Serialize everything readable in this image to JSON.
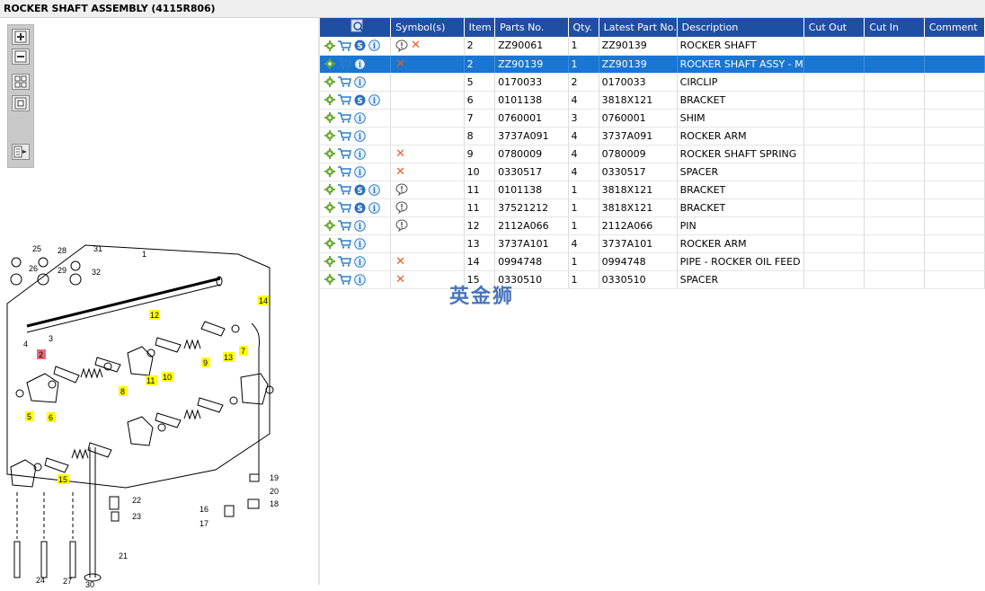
{
  "window": {
    "title": "ROCKER SHAFT ASSEMBLY (4115R806)"
  },
  "toolbar": {
    "buttons": [
      "zoom-in-icon",
      "zoom-out-icon",
      "fit-icon",
      "actual-size-icon",
      "export-icon"
    ]
  },
  "grid": {
    "headers": {
      "icons": "",
      "symbols": "Symbol(s)",
      "item": "Item",
      "parts_no": "Parts No.",
      "qty": "Qty.",
      "latest": "Latest Part No.",
      "description": "Description",
      "cut_out": "Cut Out",
      "cut_in": "Cut In",
      "comment": "Comment"
    },
    "rows": [
      {
        "item": "2",
        "parts_no": "ZZ90061",
        "qty": "1",
        "latest": "ZZ90139",
        "description": "ROCKER SHAFT",
        "s": true,
        "note": true,
        "x": true,
        "selected": false
      },
      {
        "item": "2",
        "parts_no": "ZZ90139",
        "qty": "1",
        "latest": "ZZ90139",
        "description": "ROCKER SHAFT ASSY - M",
        "s": false,
        "note": false,
        "x": true,
        "selected": true
      },
      {
        "item": "5",
        "parts_no": "0170033",
        "qty": "2",
        "latest": "0170033",
        "description": "CIRCLIP",
        "s": false,
        "note": false,
        "x": false,
        "selected": false
      },
      {
        "item": "6",
        "parts_no": "0101138",
        "qty": "4",
        "latest": "3818X121",
        "description": "BRACKET",
        "s": true,
        "note": false,
        "x": false,
        "selected": false
      },
      {
        "item": "7",
        "parts_no": "0760001",
        "qty": "3",
        "latest": "0760001",
        "description": "SHIM",
        "s": false,
        "note": false,
        "x": false,
        "selected": false
      },
      {
        "item": "8",
        "parts_no": "3737A091",
        "qty": "4",
        "latest": "3737A091",
        "description": "ROCKER ARM",
        "s": false,
        "note": false,
        "x": false,
        "selected": false
      },
      {
        "item": "9",
        "parts_no": "0780009",
        "qty": "4",
        "latest": "0780009",
        "description": "ROCKER SHAFT SPRING",
        "s": false,
        "note": false,
        "x": true,
        "selected": false
      },
      {
        "item": "10",
        "parts_no": "0330517",
        "qty": "4",
        "latest": "0330517",
        "description": "SPACER",
        "s": false,
        "note": false,
        "x": true,
        "selected": false
      },
      {
        "item": "11",
        "parts_no": "0101138",
        "qty": "1",
        "latest": "3818X121",
        "description": "BRACKET",
        "s": true,
        "note": true,
        "x": false,
        "selected": false
      },
      {
        "item": "11",
        "parts_no": "37521212",
        "qty": "1",
        "latest": "3818X121",
        "description": "BRACKET",
        "s": true,
        "note": true,
        "x": false,
        "selected": false
      },
      {
        "item": "12",
        "parts_no": "2112A066",
        "qty": "1",
        "latest": "2112A066",
        "description": "PIN",
        "s": false,
        "note": true,
        "x": false,
        "selected": false
      },
      {
        "item": "13",
        "parts_no": "3737A101",
        "qty": "4",
        "latest": "3737A101",
        "description": "ROCKER ARM",
        "s": false,
        "note": false,
        "x": false,
        "selected": false
      },
      {
        "item": "14",
        "parts_no": "0994748",
        "qty": "1",
        "latest": "0994748",
        "description": "PIPE - ROCKER OIL FEED",
        "s": false,
        "note": false,
        "x": true,
        "selected": false
      },
      {
        "item": "15",
        "parts_no": "0330510",
        "qty": "1",
        "latest": "0330510",
        "description": "SPACER",
        "s": false,
        "note": false,
        "x": true,
        "selected": false
      }
    ]
  },
  "watermark": "英金狮",
  "diagram": {
    "callouts_plain": [
      "25",
      "28",
      "31",
      "26",
      "29",
      "32",
      "1",
      "4",
      "3",
      "16",
      "17",
      "22",
      "23",
      "19",
      "20",
      "18",
      "21",
      "24",
      "27",
      "30"
    ],
    "callouts_yellow": [
      "12",
      "14",
      "7",
      "13",
      "9",
      "10",
      "11",
      "8",
      "6",
      "5",
      "15"
    ],
    "callouts_red": [
      "2"
    ]
  }
}
